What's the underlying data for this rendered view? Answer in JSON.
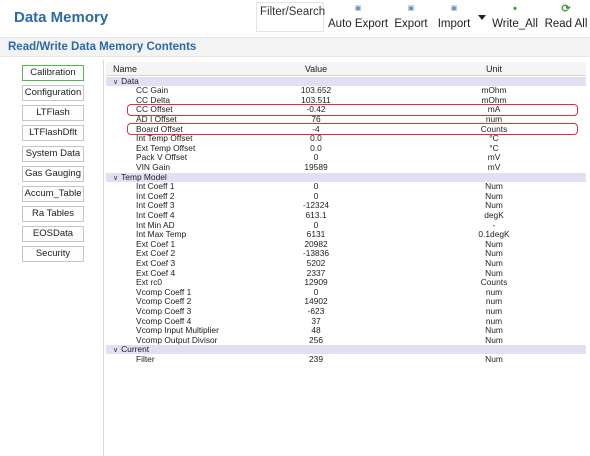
{
  "app": {
    "title": "Data Memory"
  },
  "toolbar": {
    "filter_label": "Filter/Search",
    "buttons": [
      {
        "label": "Auto Export",
        "icon": "auto-export-icon"
      },
      {
        "label": "Export",
        "icon": "export-icon"
      },
      {
        "label": "Import",
        "icon": "import-icon"
      },
      {
        "label": "Write_All",
        "icon": "write-all-icon"
      },
      {
        "label": "Read All",
        "icon": "refresh-icon"
      }
    ]
  },
  "section": {
    "title": "Read/Write Data Memory Contents"
  },
  "sidebar": {
    "items": [
      {
        "label": "Calibration",
        "active": true
      },
      {
        "label": "Configuration"
      },
      {
        "label": "LTFlash"
      },
      {
        "label": "LTFlashDflt"
      },
      {
        "label": "System Data"
      },
      {
        "label": "Gas Gauging"
      },
      {
        "label": "Accum_Table"
      },
      {
        "label": "Ra Tables"
      },
      {
        "label": "EOSData"
      },
      {
        "label": "Security"
      }
    ]
  },
  "table": {
    "headers": {
      "name": "Name",
      "value": "Value",
      "unit": "Unit"
    },
    "groups": [
      {
        "name": "Data",
        "rows": [
          {
            "name": "CC Gain",
            "value": "103.652",
            "unit": "mOhm"
          },
          {
            "name": "CC Delta",
            "value": "103.511",
            "unit": "mOhm"
          },
          {
            "name": "CC Offset",
            "value": "-0.42",
            "unit": "mA",
            "highlighted": true
          },
          {
            "name": "AD I Offset",
            "value": "76",
            "unit": "num"
          },
          {
            "name": "Board Offset",
            "value": "-4",
            "unit": "Counts",
            "highlighted": true
          },
          {
            "name": "Int Temp Offset",
            "value": "0.0",
            "unit": "°C"
          },
          {
            "name": "Ext Temp Offset",
            "value": "0.0",
            "unit": "°C"
          },
          {
            "name": "Pack V Offset",
            "value": "0",
            "unit": "mV"
          },
          {
            "name": "VIN Gain",
            "value": "19589",
            "unit": "mV"
          }
        ]
      },
      {
        "name": "Temp Model",
        "rows": [
          {
            "name": "Int Coeff 1",
            "value": "0",
            "unit": "Num"
          },
          {
            "name": "Int Coeff 2",
            "value": "0",
            "unit": "Num"
          },
          {
            "name": "Int Coeff 3",
            "value": "-12324",
            "unit": "Num"
          },
          {
            "name": "Int Coeff 4",
            "value": "613.1",
            "unit": "degK"
          },
          {
            "name": "Int Min AD",
            "value": "0",
            "unit": "-"
          },
          {
            "name": "Int Max Temp",
            "value": "6131",
            "unit": "0.1degK"
          },
          {
            "name": "Ext Coef 1",
            "value": "20982",
            "unit": "Num"
          },
          {
            "name": "Ext Coef 2",
            "value": "-13836",
            "unit": "Num"
          },
          {
            "name": "Ext Coef 3",
            "value": "5202",
            "unit": "Num"
          },
          {
            "name": "Ext Coef 4",
            "value": "2337",
            "unit": "Num"
          },
          {
            "name": "Ext rc0",
            "value": "12909",
            "unit": "Counts"
          },
          {
            "name": "Vcomp Coeff 1",
            "value": "0",
            "unit": "num"
          },
          {
            "name": "Vcomp Coeff 2",
            "value": "14902",
            "unit": "num"
          },
          {
            "name": "Vcomp Coeff 3",
            "value": "-623",
            "unit": "num"
          },
          {
            "name": "Vcomp Coeff 4",
            "value": "37",
            "unit": "num"
          },
          {
            "name": "Vcomp Input Multiplier",
            "value": "48",
            "unit": "Num"
          },
          {
            "name": "Vcomp Output Divisor",
            "value": "256",
            "unit": "Num"
          }
        ]
      },
      {
        "name": "Current",
        "rows": [
          {
            "name": "Filter",
            "value": "239",
            "unit": "Num"
          }
        ]
      }
    ]
  },
  "colors": {
    "title_blue": "#2b6aa8",
    "group_row_bg": "#dfe0f3",
    "highlight_red": "#d93434",
    "active_green": "#4cbb4c"
  }
}
